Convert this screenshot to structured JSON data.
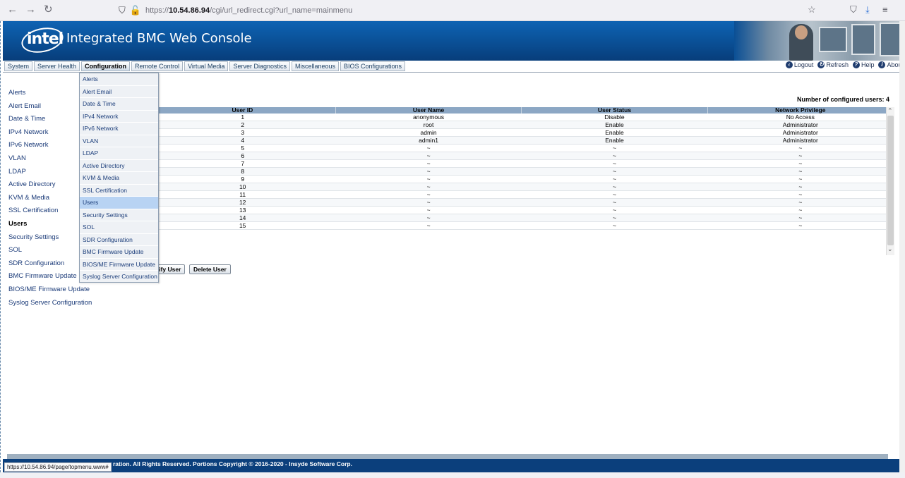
{
  "browser": {
    "url_prefix": "https://",
    "url_host": "10.54.86.94",
    "url_path": "/cgi/url_redirect.cgi?url_name=mainmenu",
    "status_url": "https://10.54.86.94/page/topmenu.www#"
  },
  "header": {
    "logo_text": "intel",
    "title": "Integrated BMC Web Console"
  },
  "tabs": [
    {
      "label": "System"
    },
    {
      "label": "Server Health"
    },
    {
      "label": "Configuration"
    },
    {
      "label": "Remote Control"
    },
    {
      "label": "Virtual Media"
    },
    {
      "label": "Server Diagnostics"
    },
    {
      "label": "Miscellaneous"
    },
    {
      "label": "BIOS Configurations"
    }
  ],
  "top_links": {
    "logout": "Logout",
    "refresh": "Refresh",
    "help": "Help",
    "about": "About"
  },
  "left_nav": [
    {
      "label": "Alerts"
    },
    {
      "label": "Alert Email"
    },
    {
      "label": "Date & Time"
    },
    {
      "label": "IPv4 Network"
    },
    {
      "label": "IPv6 Network"
    },
    {
      "label": "VLAN"
    },
    {
      "label": "LDAP"
    },
    {
      "label": "Active Directory"
    },
    {
      "label": "KVM & Media"
    },
    {
      "label": "SSL Certification"
    },
    {
      "label": "Users"
    },
    {
      "label": "Security Settings"
    },
    {
      "label": "SOL"
    },
    {
      "label": "SDR Configuration"
    },
    {
      "label": "BMC Firmware Update"
    },
    {
      "label": "BIOS/ME Firmware Update"
    },
    {
      "label": "Syslog Server Configuration"
    }
  ],
  "dropdown": [
    {
      "label": "Alerts"
    },
    {
      "label": "Alert Email"
    },
    {
      "label": "Date & Time"
    },
    {
      "label": "IPv4 Network"
    },
    {
      "label": "IPv6 Network"
    },
    {
      "label": "VLAN"
    },
    {
      "label": "LDAP"
    },
    {
      "label": "Active Directory"
    },
    {
      "label": "KVM & Media"
    },
    {
      "label": "SSL Certification"
    },
    {
      "label": "Users"
    },
    {
      "label": "Security Settings"
    },
    {
      "label": "SOL"
    },
    {
      "label": "SDR Configuration"
    },
    {
      "label": "BMC Firmware Update"
    },
    {
      "label": "BIOS/ME Firmware Update"
    },
    {
      "label": "Syslog Server Configuration"
    }
  ],
  "content": {
    "users_count": "Number of configured users: 4",
    "columns": [
      "User ID",
      "User Name",
      "User Status",
      "Network Privilege"
    ],
    "rows": [
      [
        "1",
        "anonymous",
        "Disable",
        "No Access"
      ],
      [
        "2",
        "root",
        "Enable",
        "Administrator"
      ],
      [
        "3",
        "admin",
        "Enable",
        "Administrator"
      ],
      [
        "4",
        "admin1",
        "Enable",
        "Administrator"
      ],
      [
        "5",
        "~",
        "~",
        "~"
      ],
      [
        "6",
        "~",
        "~",
        "~"
      ],
      [
        "7",
        "~",
        "~",
        "~"
      ],
      [
        "8",
        "~",
        "~",
        "~"
      ],
      [
        "9",
        "~",
        "~",
        "~"
      ],
      [
        "10",
        "~",
        "~",
        "~"
      ],
      [
        "11",
        "~",
        "~",
        "~"
      ],
      [
        "12",
        "~",
        "~",
        "~"
      ],
      [
        "13",
        "~",
        "~",
        "~"
      ],
      [
        "14",
        "~",
        "~",
        "~"
      ],
      [
        "15",
        "~",
        "~",
        "~"
      ]
    ],
    "modify_button": "dify User",
    "delete_button": "Delete User"
  },
  "footer": {
    "text": "ration. All Rights Reserved. Portions Copyright © 2016-2020 - Insyde Software Corp."
  }
}
